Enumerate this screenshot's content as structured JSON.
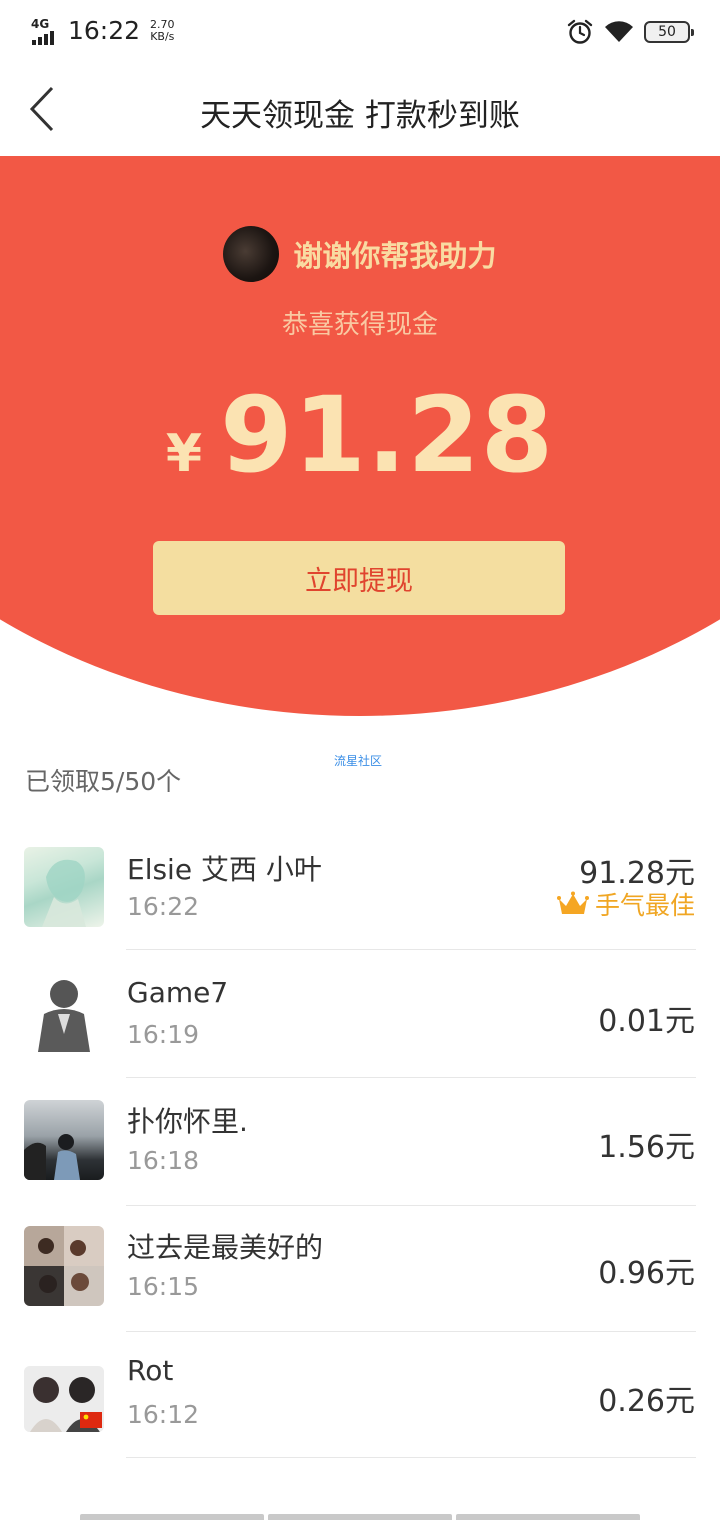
{
  "status_bar": {
    "network": "4G",
    "time": "16:22",
    "speed_value": "2.70",
    "speed_unit": "KB/s",
    "battery": "50",
    "icons": [
      "signal-icon",
      "alarm-icon",
      "wifi-icon",
      "battery-icon"
    ]
  },
  "nav": {
    "title": "天天领现金 打款秒到账",
    "back_icon": "chevron-left-icon"
  },
  "hero": {
    "thanks": "谢谢你帮我助力",
    "congrats": "恭喜获得现金",
    "currency": "¥",
    "amount": "91.28",
    "button": "立即提现",
    "colors": {
      "background": "#f25845",
      "button": "#f4dea0",
      "button_text": "#e0442e",
      "amount_text": "#fbe3b2"
    }
  },
  "list": {
    "count_label": "已领取5/50个",
    "watermark": "流星社区",
    "best_label": "手气最佳",
    "items": [
      {
        "name": "Elsie 艾西 小叶",
        "time": "16:22",
        "amount": "91.28元",
        "best": true
      },
      {
        "name": "Game7",
        "time": "16:19",
        "amount": "0.01元",
        "best": false
      },
      {
        "name": "扑你怀里.",
        "time": "16:18",
        "amount": "1.56元",
        "best": false
      },
      {
        "name": "过去是最美好的",
        "time": "16:15",
        "amount": "0.96元",
        "best": false
      },
      {
        "name": "Rot",
        "time": "16:12",
        "amount": "0.26元",
        "best": false
      }
    ]
  }
}
